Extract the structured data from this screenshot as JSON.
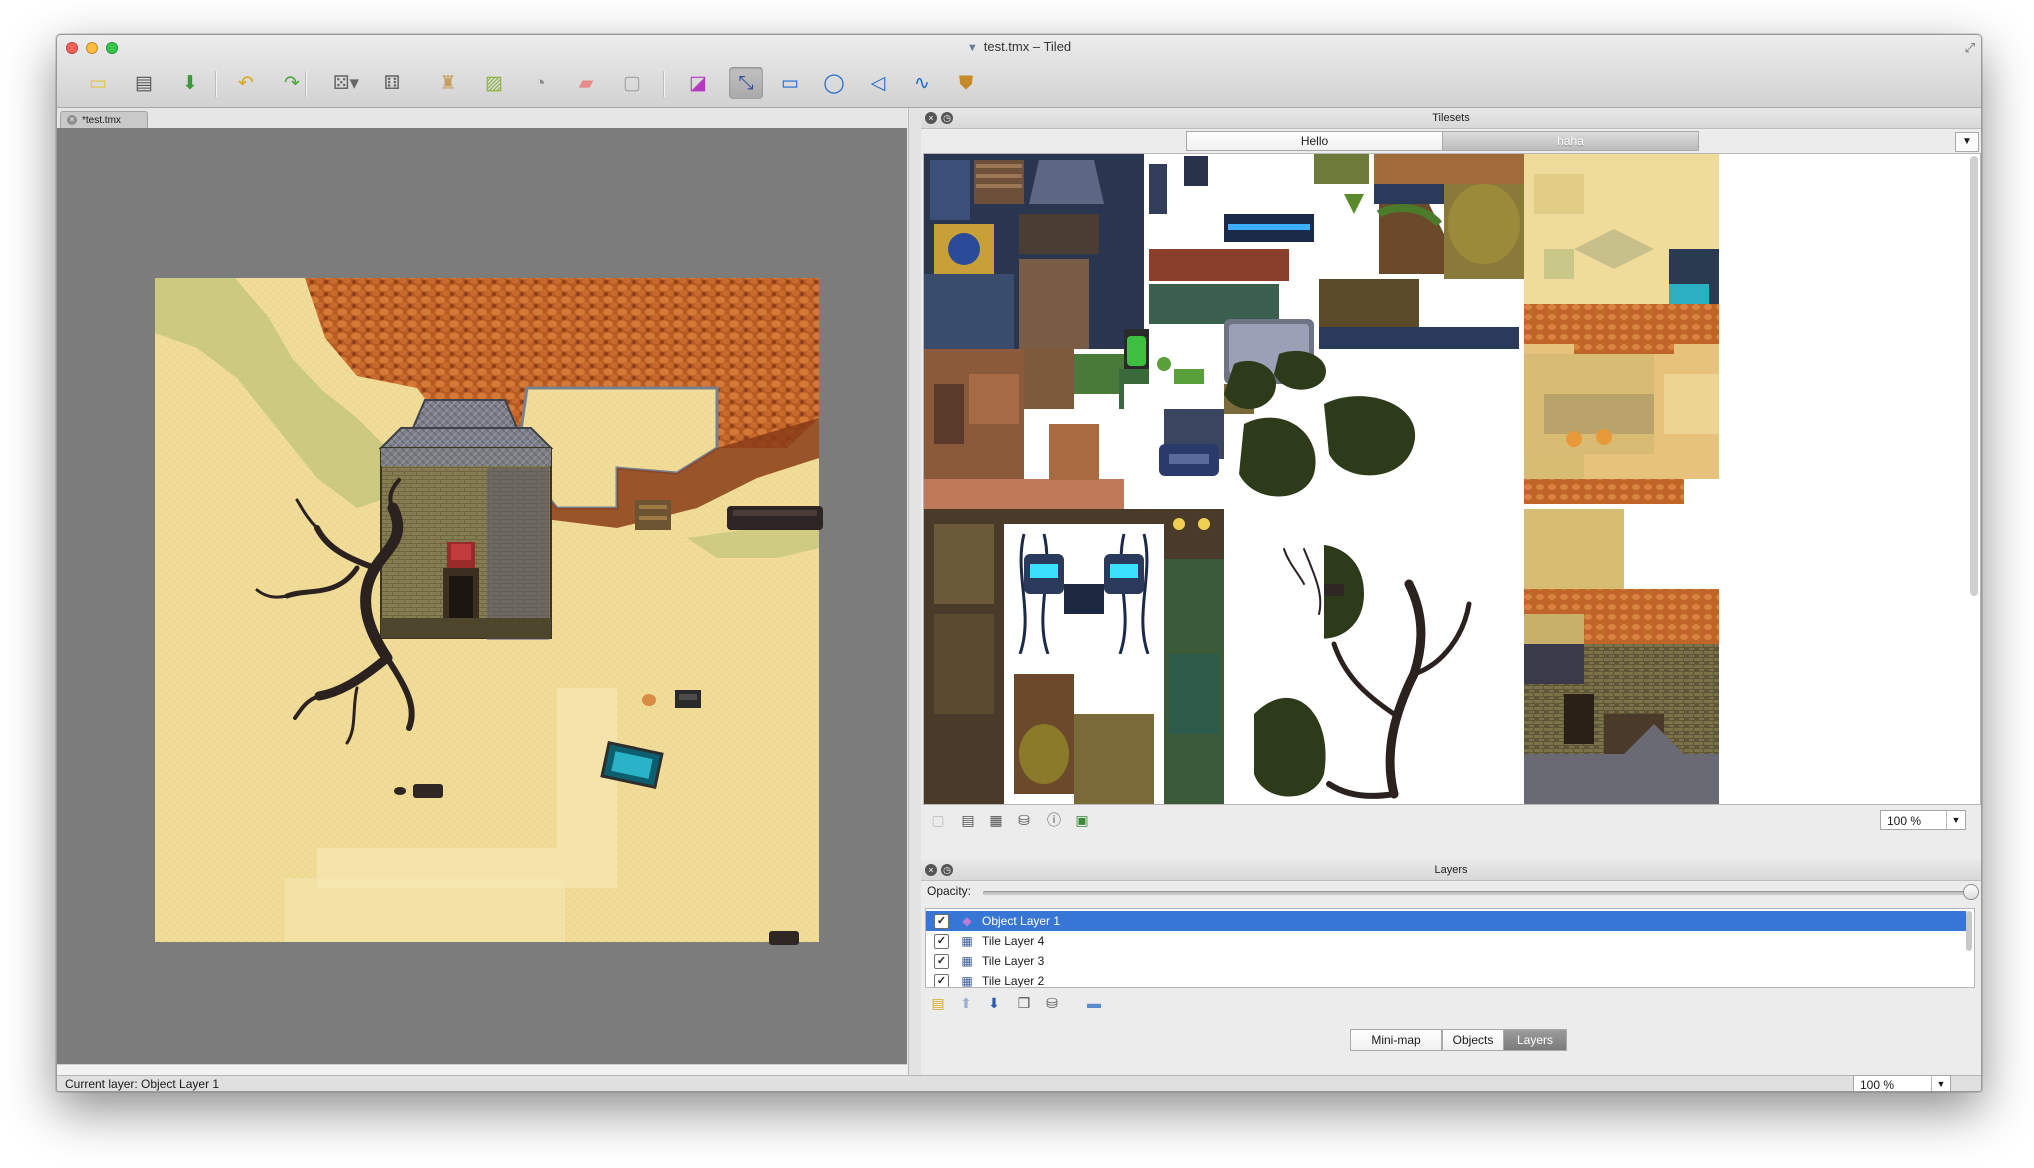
{
  "window": {
    "title": "test.tmx – Tiled",
    "document_icon": "tmx-file-icon"
  },
  "toolbar": {
    "buttons": [
      {
        "name": "new-map-button",
        "icon": "new-document-icon",
        "glyph": "▭",
        "color": "#e6c43a"
      },
      {
        "name": "open-map-button",
        "icon": "open-folder-icon",
        "glyph": "▤",
        "color": "#555555"
      },
      {
        "name": "save-map-button",
        "icon": "save-download-icon",
        "glyph": "⬇",
        "color": "#3a9a3a"
      },
      {
        "name": "undo-button",
        "icon": "undo-arrow-icon",
        "glyph": "↶",
        "color": "#d9a91d"
      },
      {
        "name": "redo-button",
        "icon": "redo-arrow-icon",
        "glyph": "↷",
        "color": "#4aa93a"
      },
      {
        "name": "random-mode-button",
        "icon": "dice-menu-icon",
        "glyph": "⚄▾",
        "color": "#666666"
      },
      {
        "name": "random-dice-button",
        "icon": "dice-icon",
        "glyph": "⚅",
        "color": "#666666"
      },
      {
        "name": "stamp-brush-button",
        "icon": "stamp-icon",
        "glyph": "♜",
        "color": "#c7a061"
      },
      {
        "name": "terrain-brush-button",
        "icon": "terrain-brush-icon",
        "glyph": "▨",
        "color": "#89b23a"
      },
      {
        "name": "bucket-fill-button",
        "icon": "bucket-fill-icon",
        "glyph": "◔",
        "color": "#8a8a8a"
      },
      {
        "name": "eraser-button",
        "icon": "eraser-icon",
        "glyph": "▰",
        "color": "#e88a8a"
      },
      {
        "name": "rect-select-button",
        "icon": "rectangle-select-icon",
        "glyph": "▢",
        "color": "#a0a0a0"
      },
      {
        "name": "select-objects-button",
        "icon": "select-objects-icon",
        "glyph": "◪",
        "color": "#b43ac0"
      },
      {
        "name": "edit-polygons-button",
        "icon": "edit-polygons-icon",
        "glyph": "⤡",
        "color": "#2a4a9a"
      },
      {
        "name": "insert-rectangle-button",
        "icon": "insert-rectangle-icon",
        "glyph": "▭",
        "color": "#1a6ad0"
      },
      {
        "name": "insert-ellipse-button",
        "icon": "insert-ellipse-icon",
        "glyph": "◯",
        "color": "#1a6ad0"
      },
      {
        "name": "insert-polygon-button",
        "icon": "insert-polygon-icon",
        "glyph": "◁",
        "color": "#1a6ad0"
      },
      {
        "name": "insert-polyline-button",
        "icon": "insert-polyline-icon",
        "glyph": "∿",
        "color": "#1a6ad0"
      },
      {
        "name": "insert-tile-button",
        "icon": "insert-tile-icon",
        "glyph": "⛊",
        "color": "#c78a2a"
      }
    ]
  },
  "document": {
    "tab_label": "*test.tmx"
  },
  "tilesets": {
    "title": "Tilesets",
    "tabs": [
      "Hello",
      "haha"
    ],
    "selected_tab": "haha",
    "zoom": "100 %"
  },
  "layers": {
    "title": "Layers",
    "opacity_label": "Opacity:",
    "opacity": 1.0,
    "items": [
      {
        "name": "Object Layer 1",
        "type": "object",
        "visible": true,
        "selected": true
      },
      {
        "name": "Tile Layer 4",
        "type": "tile",
        "visible": true,
        "selected": false
      },
      {
        "name": "Tile Layer 3",
        "type": "tile",
        "visible": true,
        "selected": false
      },
      {
        "name": "Tile Layer 2",
        "type": "tile",
        "visible": true,
        "selected": false
      }
    ]
  },
  "bottom_tabs": [
    "Mini-map",
    "Objects",
    "Layers"
  ],
  "bottom_selected": "Layers",
  "status": {
    "current_layer": "Current layer: Object Layer 1",
    "zoom": "100 %"
  },
  "colors": {
    "sand": "#f0dc97",
    "dirt_cliff": "#c0642a",
    "selection_blue": "#3876d6",
    "canvas_gray": "#7c7c7c"
  }
}
